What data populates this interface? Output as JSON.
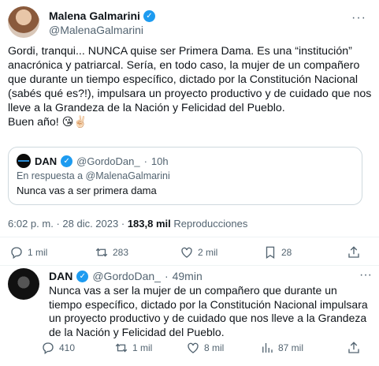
{
  "tweet": {
    "author_name": "Malena Galmarini",
    "author_handle": "@MalenaGalmarini",
    "text": "Gordi, tranqui... NUNCA quise ser Primera Dama. Es una “institución” anacrónica y patriarcal. Sería, en todo caso, la mujer de un compañero que durante un tiempo específico, dictado por la Constitución Nacional (sabés qué es?!), impulsara un proyecto productivo y de cuidado que nos lleve a la Grandeza de la Nación y Felicidad del Pueblo.",
    "text2": "Buen año! 😘✌🏻",
    "time": "6:02 p. m.",
    "date": "28 dic. 2023",
    "views": "183,8 mil",
    "views_label": "Reproducciones",
    "replies": "1 mil",
    "retweets": "283",
    "likes": "2 mil",
    "bookmarks": "28"
  },
  "quote": {
    "author_name": "DAN",
    "author_handle": "@GordoDan_",
    "time": "10h",
    "reply_to": "En respuesta a @MalenaGalmarini",
    "text": "Nunca vas a ser primera dama"
  },
  "reply": {
    "author_name": "DAN",
    "author_handle": "@GordoDan_",
    "time": "49min",
    "text": "Nunca vas a ser la mujer de un compañero que durante un tiempo específico, dictado por la Constitución Nacional impulsara un proyecto productivo y de cuidado que nos lleve a la Grandeza de la Nación y Felicidad del Pueblo.",
    "replies": "410",
    "retweets": "1 mil",
    "likes": "8 mil",
    "views": "87 mil"
  },
  "colors": {
    "accent": "#1d9bf0",
    "muted": "#536471",
    "border": "#cfd9de"
  },
  "icons": [
    "verified-badge-icon",
    "more-icon",
    "reply-icon",
    "retweet-icon",
    "like-icon",
    "bookmark-icon",
    "share-icon",
    "views-icon"
  ]
}
